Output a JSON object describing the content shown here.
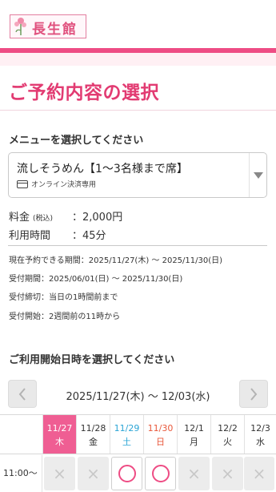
{
  "brand": {
    "logo_text": "長生館"
  },
  "page": {
    "title": "ご予約内容の選択"
  },
  "menu_section": {
    "label": "メニューを選択してください",
    "selected_menu": "流しそうめん【1〜3名様まで席】",
    "payment_note": "オンライン決済専用"
  },
  "info": {
    "price_label": "料金",
    "price_tax": "(税込)",
    "price_value": "：2,000円",
    "duration_label": "利用時間",
    "duration_value": "：45分"
  },
  "notes": {
    "bookable_period": "現在予約できる期間：2025/11/27(木) 〜 2025/11/30(日)",
    "reception_period": "受付期間：2025/06/01(日) 〜 2025/11/30(日)",
    "deadline": "受付締切：当日の1時間前まで",
    "start": "受付開始：2週間前の11時から"
  },
  "date_section": {
    "label": "ご利用開始日時を選択してください",
    "range": "2025/11/27(木) 〜 12/03(水)"
  },
  "calendar": {
    "days": [
      {
        "date": "11/27",
        "dow": "木"
      },
      {
        "date": "11/28",
        "dow": "金"
      },
      {
        "date": "11/29",
        "dow": "土"
      },
      {
        "date": "11/30",
        "dow": "日"
      },
      {
        "date": "12/1",
        "dow": "月"
      },
      {
        "date": "12/2",
        "dow": "火"
      },
      {
        "date": "12/3",
        "dow": "水"
      }
    ],
    "rows": [
      {
        "time": "11:00〜",
        "slots": [
          "×",
          "×",
          "○",
          "○",
          "×",
          "×",
          "×"
        ]
      }
    ]
  },
  "colors": {
    "accent": "#ee4c84",
    "saturday": "#2aa4d5",
    "sunday": "#e8583b"
  },
  "icons": {
    "prev": "chevron-left-icon",
    "next": "chevron-right-icon",
    "card": "credit-card-icon",
    "dropdown": "caret-down-icon"
  }
}
